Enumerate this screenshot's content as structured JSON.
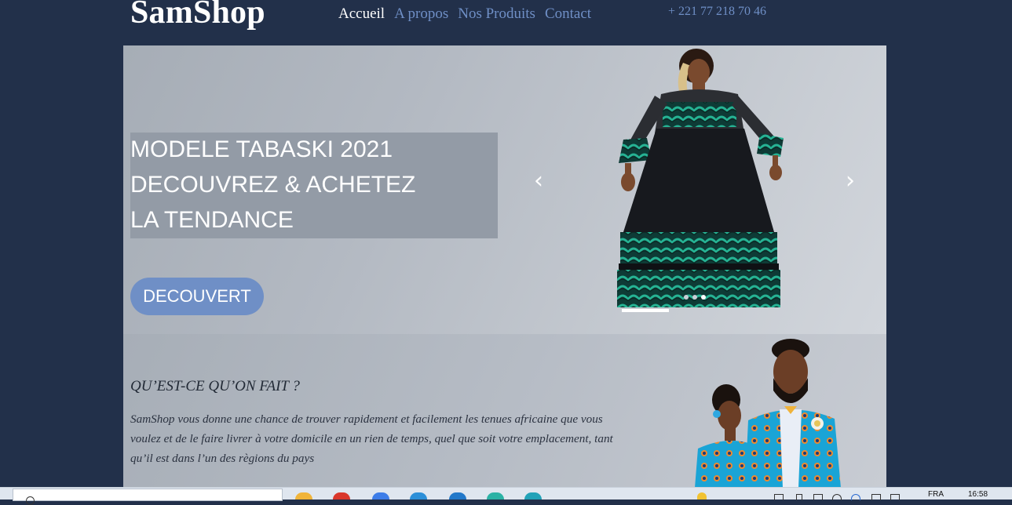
{
  "header": {
    "logo": "SamShop",
    "nav": [
      "Accueil",
      "A propos",
      "Nos Produits",
      "Contact"
    ],
    "phone": "+ 221 77 218 70 46"
  },
  "hero": {
    "lines": [
      "MODELE TABASKI 2021",
      "DECOUVREZ & ACHETEZ",
      "LA TENDANCE"
    ],
    "cta": "DECOUVERT",
    "prev_icon": "chevron-left-icon",
    "next_icon": "chevron-right-icon",
    "slide_count": 3,
    "active_slide": 3
  },
  "about": {
    "title": "QU’EST-CE QU’ON FAIT ?",
    "text": "SamShop vous donne une chance de trouver rapidement et facilement les tenues africaine que vous voulez et de le faire livrer à votre domicile en un rien de temps, quel que soit votre emplacement, tant qu’il est dans l’un des règions du pays"
  },
  "taskbar": {
    "language": "FRA",
    "time": "16:58"
  },
  "colors": {
    "background": "#22304a",
    "accent": "#6f8fc6",
    "dress_green": "#1c9a7e"
  }
}
